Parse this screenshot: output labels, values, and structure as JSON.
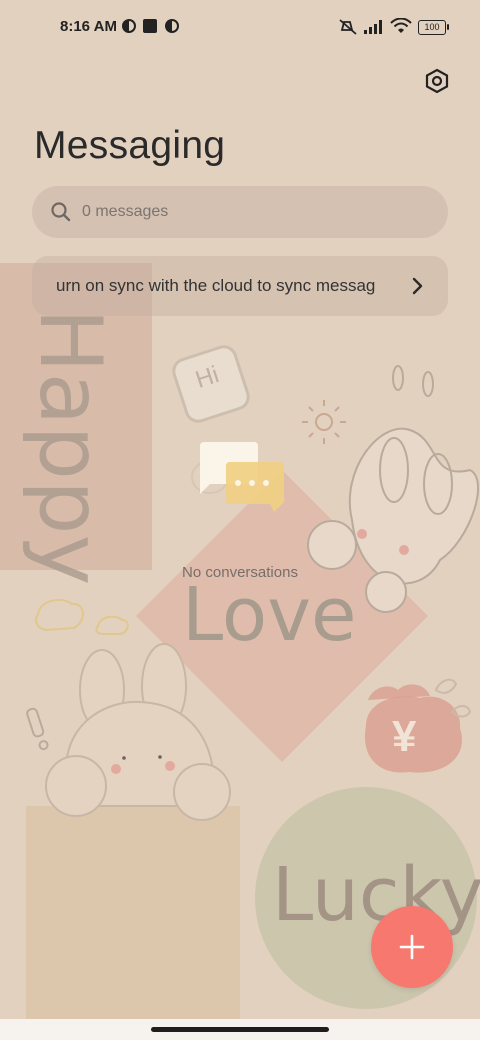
{
  "status_bar": {
    "time": "8:16 AM",
    "battery": "100"
  },
  "header": {
    "title": "Messaging",
    "settings_icon": "settings-hexagon-icon"
  },
  "search": {
    "placeholder": "0 messages",
    "icon": "search-icon"
  },
  "sync_banner": {
    "text": "urn on sync with the cloud to sync messag",
    "icon": "chevron-right-icon"
  },
  "empty_state": {
    "text": "No conversations",
    "icon": "chat-bubbles-icon"
  },
  "wallpaper": {
    "happy": "Happy",
    "hi": "Hi",
    "love": "Love",
    "lucky": "Lucky",
    "yen": "¥"
  },
  "fab": {
    "icon": "plus-icon"
  },
  "colors": {
    "background": "#e3d1c0",
    "fab": "#f6786f",
    "search_bg": "#d9c7b8"
  }
}
